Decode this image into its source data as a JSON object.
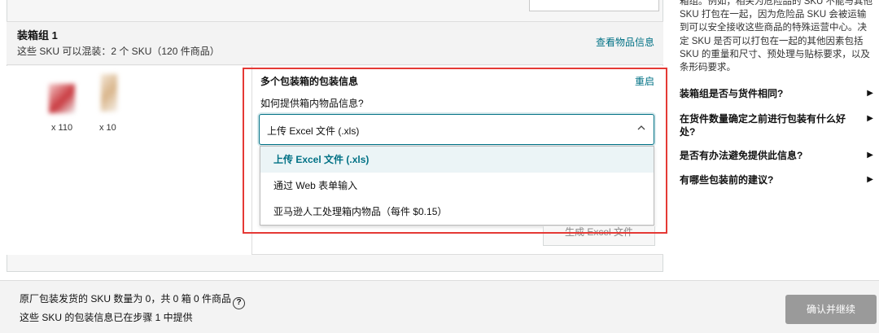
{
  "group": {
    "title": "装箱组 1",
    "subtitle": "这些 SKU 可以混装：2 个 SKU（120 件商品）",
    "view_link": "查看物品信息"
  },
  "items": [
    {
      "qty": "x 110"
    },
    {
      "qty": "x 10"
    }
  ],
  "packing": {
    "section_title": "多个包装箱的包装信息",
    "reset_link": "重启",
    "question": "如何提供箱内物品信息?",
    "selected_value": "上传 Excel 文件 (.xls)",
    "options": [
      "上传 Excel 文件 (.xls)",
      "通过 Web 表单输入",
      "亚马逊人工处理箱内物品（每件 $0.15）"
    ],
    "generate_button": "生成 Excel 文件"
  },
  "footer": {
    "line1": "原厂包装发货的 SKU 数量为 0，共 0 箱 0 件商品",
    "help_glyph": "?",
    "line2": "这些 SKU 的包装信息已在步骤 1 中提供",
    "confirm_button": "确认并继续"
  },
  "sidebar": {
    "help_text": "箱组。例如，相关为危险品的 SKU 不能与其他 SKU 打包在一起，因为危险品 SKU 会被运输到可以安全接收这些商品的特殊运营中心。决定 SKU 是否可以打包在一起的其他因素包括 SKU 的重量和尺寸、预处理与贴标要求，以及条形码要求。",
    "faqs": [
      "装箱组是否与货件相同?",
      "在货件数量确定之前进行包装有什么好处?",
      "是否有办法避免提供此信息?",
      "有哪些包装前的建议?"
    ]
  },
  "colors": {
    "link": "#007185",
    "highlight_frame": "#e53935",
    "confirm_disabled": "#9a9a9a"
  }
}
